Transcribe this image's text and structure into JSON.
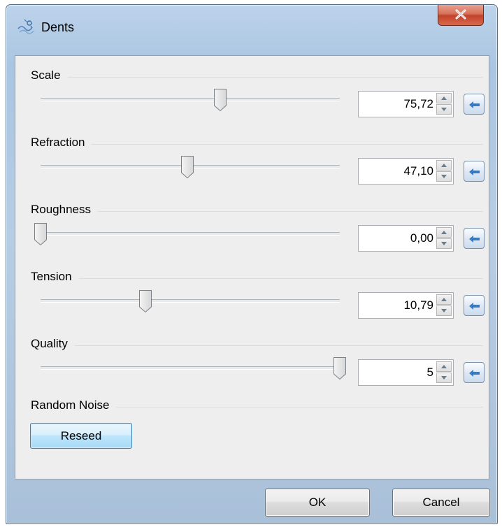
{
  "window": {
    "title": "Dents",
    "icon": "dents-effect-icon",
    "close_icon": "close-icon"
  },
  "sliders": [
    {
      "label": "Scale",
      "value": "75,72",
      "min": 0,
      "max": 100,
      "level": 0.6
    },
    {
      "label": "Refraction",
      "value": "47,10",
      "min": 0,
      "max": 100,
      "level": 0.49
    },
    {
      "label": "Roughness",
      "value": "0,00",
      "min": 0,
      "max": 100,
      "level": 0.0
    },
    {
      "label": "Tension",
      "value": "10,79",
      "min": 0,
      "max": 100,
      "level": 0.35
    },
    {
      "label": "Quality",
      "value": "5",
      "min": 1,
      "max": 5,
      "level": 1.0
    }
  ],
  "random_noise": {
    "label": "Random Noise",
    "reseed_label": "Reseed"
  },
  "footer": {
    "ok_label": "OK",
    "cancel_label": "Cancel"
  },
  "colors": {
    "titlebar": "#aac5e1",
    "client_bg": "#eeeeee",
    "close_red": "#c2422a",
    "reseed_blue": "#bee6fd"
  }
}
